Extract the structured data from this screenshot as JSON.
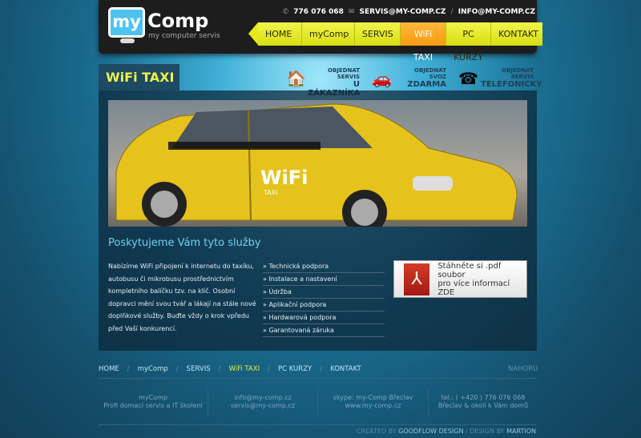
{
  "header": {
    "logo_my": "my",
    "logo_comp": "Comp",
    "logo_sub": "my computer servis",
    "phone": "776 076 068",
    "email1": "SERVIS@MY-COMP.CZ",
    "email2": "INFO@MY-COMP.CZ",
    "sep": "/"
  },
  "nav": [
    {
      "label": "HOME"
    },
    {
      "label": "myComp"
    },
    {
      "label": "SERVIS"
    },
    {
      "label": "WiFi TAXI",
      "active": true
    },
    {
      "label": "PC KURZY"
    },
    {
      "label": "KONTAKT"
    }
  ],
  "page_title": "WiFi TAXI",
  "orders": [
    {
      "small": "OBJEDNAT SERVIS",
      "big": "U ZÁKAZNÍKA",
      "icon": "house-icon"
    },
    {
      "small": "OBJEDNAT SVOZ",
      "big": "ZDARMA",
      "icon": "car-icon"
    },
    {
      "small": "OBJEDNAT SERVIS",
      "big": "TELEFONICKY",
      "icon": "telephone-icon"
    }
  ],
  "hero": {
    "sign": "WiFi",
    "sign_sub": "TAXI"
  },
  "services": {
    "title": "Poskytujeme Vám tyto služby",
    "text": "Nabízíme WiFi připojení k internetu do taxíku, autobusu či mikrobusu prostřednictvím kompletního balíčku tzv. na klíč. Osobní dopravci mění svou tvář a lákají na stále nové doplňkové služby. Buďte vždy o krok vpředu před Vaší konkurencí.",
    "list": [
      "» Technická podpora",
      "» Instalace a nastavení",
      "» Údržba",
      "» Aplikační podpora",
      "» Hardwarová podpora",
      "» Garantovaná záruka"
    ]
  },
  "pdf": {
    "line1": "Stáhněte si .pdf soubor",
    "line2": "pro více informací ZDE"
  },
  "footer": {
    "nav": [
      "HOME",
      "myComp",
      "SERVIS",
      "WiFi TAXI",
      "PC KURZY",
      "KONTAKT"
    ],
    "sep": "/",
    "top": "NAHORU",
    "cols": [
      [
        "myComp",
        "Profi domací servis a IT školení"
      ],
      [
        "info@my-comp.cz",
        "servis@my-comp.cz"
      ],
      [
        "skype: my-Comp Břeclav",
        "www.my-comp.cz"
      ],
      [
        "tel.: ( +420 ) 776 076 068",
        "Břeclav & okolí k Vám domů"
      ]
    ],
    "created_by": "CREATED BY",
    "created_name": "GOODFLOW DESIGN",
    "design_by": "DESIGN BY",
    "design_name": "MARTION"
  },
  "colors": {
    "nav_yellow": "#e3ea18",
    "nav_active": "#f79c12",
    "title_yellow": "#ecf24a",
    "heading_blue": "#6fd0f2"
  }
}
